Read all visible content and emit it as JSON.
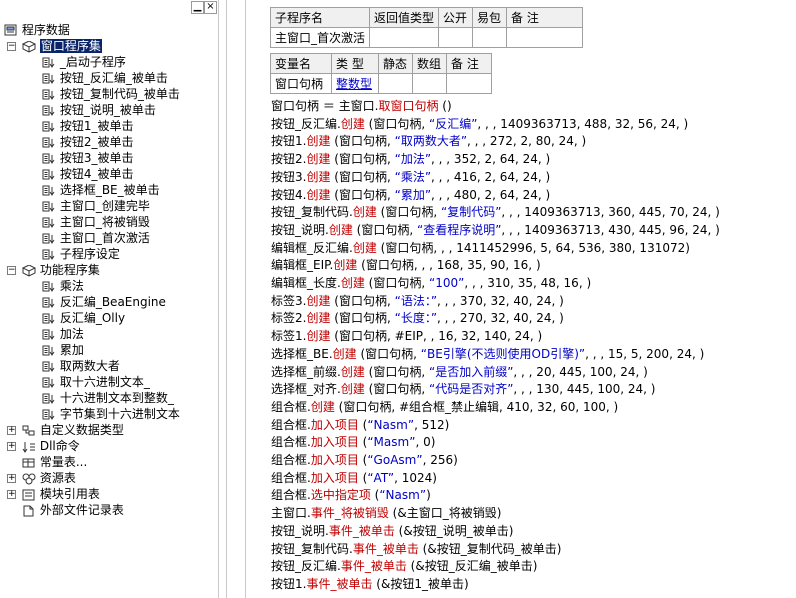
{
  "window": {
    "btn_minimize": "▁",
    "btn_close": "×"
  },
  "tree": {
    "root": "程序数据",
    "groups": [
      {
        "label": "窗口程序集",
        "children": [
          "_启动子程序",
          "按钮_反汇编_被单击",
          "按钮_复制代码_被单击",
          "按钮_说明_被单击",
          "按钮1_被单击",
          "按钮2_被单击",
          "按钮3_被单击",
          "按钮4_被单击",
          "选择框_BE_被单击",
          "主窗口_创建完毕",
          "主窗口_将被销毁",
          "主窗口_首次激活",
          "子程序设定"
        ]
      },
      {
        "label": "功能程序集",
        "children": [
          "乘法",
          "反汇编_BeaEngine",
          "反汇编_Olly",
          "加法",
          "累加",
          "取两数大者",
          "取十六进制文本_",
          "十六进制文本到整数_",
          "字节集到十六进制文本"
        ]
      }
    ],
    "others": [
      "自定义数据类型",
      "Dll命令",
      "常量表...",
      "资源表",
      "模块引用表",
      "外部文件记录表"
    ]
  },
  "sub_table": {
    "headers": [
      "子程序名",
      "返回值类型",
      "公开",
      "易包",
      "备 注"
    ],
    "row": [
      "主窗口_首次激活",
      "",
      "",
      "",
      ""
    ]
  },
  "var_table": {
    "headers": [
      "变量名",
      "类 型",
      "静态",
      "数组",
      "备 注"
    ],
    "row": [
      "窗口句柄",
      "整数型",
      "",
      "",
      ""
    ]
  },
  "code": [
    [
      "窗口句柄 ＝ 主窗口.",
      "取窗口句柄",
      " ()"
    ],
    [
      "按钮_反汇编.",
      "创建",
      " (窗口句柄, ",
      "“反汇编”",
      ", , , 1409363713, 488, 32, 56, 24, )"
    ],
    [
      "按钮1.",
      "创建",
      " (窗口句柄, ",
      "“取两数大者”",
      ", , , 272, 2, 80, 24, )"
    ],
    [
      "按钮2.",
      "创建",
      " (窗口句柄, ",
      "“加法”",
      ", , , 352, 2, 64, 24, )"
    ],
    [
      "按钮3.",
      "创建",
      " (窗口句柄, ",
      "“乘法”",
      ", , , 416, 2, 64, 24, )"
    ],
    [
      "按钮4.",
      "创建",
      " (窗口句柄, ",
      "“累加”",
      ", , , 480, 2, 64, 24, )"
    ],
    [
      "按钮_复制代码.",
      "创建",
      " (窗口句柄, ",
      "“复制代码”",
      ", , , 1409363713, 360, 445, 70, 24, )"
    ],
    [
      "按钮_说明.",
      "创建",
      " (窗口句柄, ",
      "“查看程序说明”",
      ", , , 1409363713, 430, 445, 96, 24, )"
    ],
    [
      "编辑框_反汇编.",
      "创建",
      " (窗口句柄, , , 1411452996, 5, 64, 536, 380, 131072)",
      "",
      ""
    ],
    [
      "编辑框_EIP.",
      "创建",
      " (窗口句柄, , , 168, 35, 90, 16, )",
      "",
      ""
    ],
    [
      "编辑框_长度.",
      "创建",
      " (窗口句柄, ",
      "“100”",
      ", , , 310, 35, 48, 16, )"
    ],
    [
      "标签3.",
      "创建",
      " (窗口句柄, ",
      "“语法：”",
      ", , , 370, 32, 40, 24, )"
    ],
    [
      "标签2.",
      "创建",
      " (窗口句柄, ",
      "“长度：”",
      ", , , 270, 32, 40, 24, )"
    ],
    [
      "标签1.",
      "创建",
      " (窗口句柄, #EIP, , 16, 32, 140, 24, )",
      "",
      ""
    ],
    [
      "选择框_BE.",
      "创建",
      " (窗口句柄, ",
      "“BE引擎(不选则使用OD引擎)”",
      ", , , 15, 5, 200, 24, )"
    ],
    [
      "选择框_前缀.",
      "创建",
      " (窗口句柄, ",
      "“是否加入前缀”",
      ", , , 20, 445, 100, 24, )"
    ],
    [
      "选择框_对齐.",
      "创建",
      " (窗口句柄, ",
      "“代码是否对齐”",
      ", , , 130, 445, 100, 24, )"
    ],
    [
      "组合框.",
      "创建",
      " (窗口句柄, #组合框_禁止编辑, 410, 32, 60, 100, )",
      "",
      ""
    ],
    [
      "组合框.",
      "加入项目",
      " (",
      "“Nasm”",
      ", 512)"
    ],
    [
      "组合框.",
      "加入项目",
      " (",
      "“Masm”",
      ", 0)"
    ],
    [
      "组合框.",
      "加入项目",
      " (",
      "“GoAsm”",
      ", 256)"
    ],
    [
      "组合框.",
      "加入项目",
      " (",
      "“AT”",
      ", 1024)"
    ],
    [
      "组合框.",
      "选中指定项",
      " (",
      "“Nasm”",
      ")"
    ],
    [
      "主窗口.",
      "事件_将被销毁",
      " (&主窗口_将被销毁)",
      "",
      ""
    ],
    [
      "按钮_说明.",
      "事件_被单击",
      " (&按钮_说明_被单击)",
      "",
      ""
    ],
    [
      "按钮_复制代码.",
      "事件_被单击",
      " (&按钮_复制代码_被单击)",
      "",
      ""
    ],
    [
      "按钮_反汇编.",
      "事件_被单击",
      " (&按钮_反汇编_被单击)",
      "",
      ""
    ],
    [
      "按钮1.",
      "事件_被单击",
      " (&按钮1_被单击)",
      "",
      ""
    ]
  ]
}
